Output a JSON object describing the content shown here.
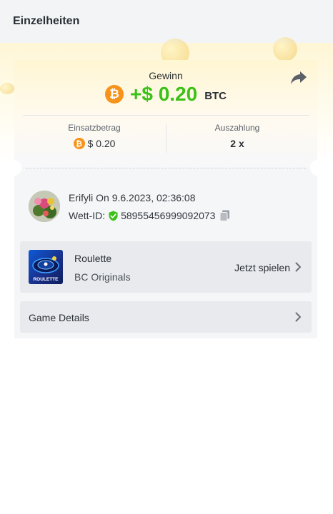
{
  "header": {
    "title": "Einzelheiten"
  },
  "win": {
    "label": "Gewinn",
    "amount": "+$ 0.20",
    "currency": "BTC",
    "currency_icon": "bitcoin-icon",
    "accent_color": "#3bc117"
  },
  "stats": {
    "stake_label": "Einsatzbetrag",
    "stake_value": "$ 0.20",
    "payout_label": "Auszahlung",
    "payout_value": "2 x"
  },
  "bet": {
    "user_name": "Erifyli",
    "on_text": "On",
    "datetime": "9.6.2023, 02:36:08",
    "bet_id_label": "Wett-ID:",
    "bet_id": "58955456999092073"
  },
  "game": {
    "name": "Roulette",
    "provider": "BC Originals",
    "thumb_text": "ROULETTE",
    "play_label": "Jetzt spielen"
  },
  "details": {
    "label": "Game Details"
  }
}
